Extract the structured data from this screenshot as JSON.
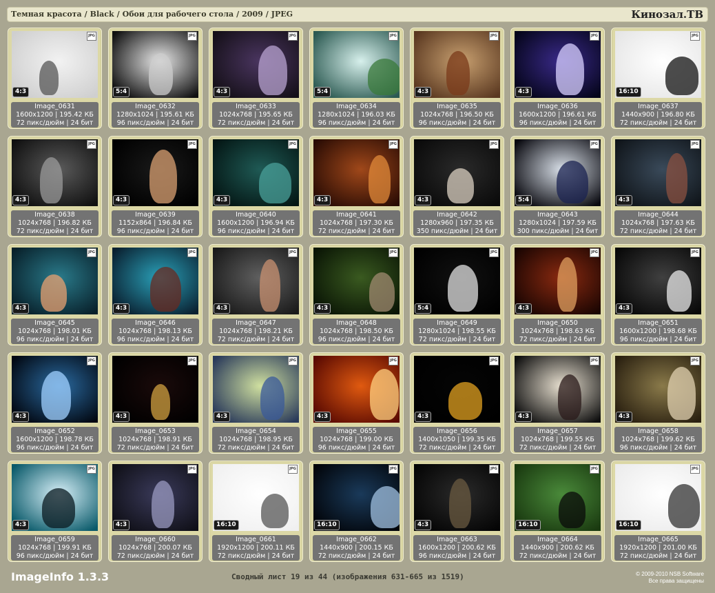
{
  "header": {
    "breadcrumb": [
      "Темная красота",
      "Black",
      "Обои для рабочего стола",
      "2009",
      "JPEG"
    ],
    "separator": "/",
    "brand": "Кинозал.ТВ"
  },
  "file_badge": "JPG",
  "images": [
    {
      "name": "Image_0631",
      "ratio": "4:3",
      "dims": "1600x1200",
      "size": "195.42 КБ",
      "dpi": "72 пикс/дюйм",
      "bits": "24 бит",
      "c1": "#f2f2f2",
      "c2": "#cfcfcf",
      "f": "#555"
    },
    {
      "name": "Image_0632",
      "ratio": "5:4",
      "dims": "1280x1024",
      "size": "195.61 КБ",
      "dpi": "96 пикс/дюйм",
      "bits": "24 бит",
      "c1": "#e8e8e8",
      "c2": "#111111",
      "f": "#ccc"
    },
    {
      "name": "Image_0633",
      "ratio": "4:3",
      "dims": "1024x768",
      "size": "195.65 КБ",
      "dpi": "72 пикс/дюйм",
      "bits": "24 бит",
      "c1": "#4a3560",
      "c2": "#151018",
      "f": "#b8a3d0"
    },
    {
      "name": "Image_0634",
      "ratio": "5:4",
      "dims": "1280x1024",
      "size": "196.03 КБ",
      "dpi": "96 пикс/дюйм",
      "bits": "24 бит",
      "c1": "#d7f0ec",
      "c2": "#2c5a52",
      "f": "#3a7a3a"
    },
    {
      "name": "Image_0635",
      "ratio": "4:3",
      "dims": "1024x768",
      "size": "196.50 КБ",
      "dpi": "96 пикс/дюйм",
      "bits": "24 бит",
      "c1": "#c8a070",
      "c2": "#5a3820",
      "f": "#7a3a1a"
    },
    {
      "name": "Image_0636",
      "ratio": "4:3",
      "dims": "1600x1200",
      "size": "196.61 КБ",
      "dpi": "96 пикс/дюйм",
      "bits": "24 бит",
      "c1": "#3a2a8a",
      "c2": "#05051a",
      "f": "#d8d0ff"
    },
    {
      "name": "Image_0637",
      "ratio": "16:10",
      "dims": "1440x900",
      "size": "196.80 КБ",
      "dpi": "72 пикс/дюйм",
      "bits": "24 бит",
      "c1": "#ffffff",
      "c2": "#e6e6e6",
      "f": "#111"
    },
    {
      "name": "Image_0638",
      "ratio": "4:3",
      "dims": "1024x768",
      "size": "196.82 КБ",
      "dpi": "72 пикс/дюйм",
      "bits": "24 бит",
      "c1": "#5a5a5a",
      "c2": "#101010",
      "f": "#999"
    },
    {
      "name": "Image_0639",
      "ratio": "4:3",
      "dims": "1152x864",
      "size": "196.84 КБ",
      "dpi": "96 пикс/дюйм",
      "bits": "24 бит",
      "c1": "#1a1a1a",
      "c2": "#000000",
      "f": "#d9a072"
    },
    {
      "name": "Image_0640",
      "ratio": "4:3",
      "dims": "1600x1200",
      "size": "196.94 КБ",
      "dpi": "96 пикс/дюйм",
      "bits": "24 бит",
      "c1": "#1f5a55",
      "c2": "#041614",
      "f": "#4aa09a"
    },
    {
      "name": "Image_0641",
      "ratio": "4:3",
      "dims": "1024x768",
      "size": "197.30 КБ",
      "dpi": "72 пикс/дюйм",
      "bits": "24 бит",
      "c1": "#a0481a",
      "c2": "#2a0c04",
      "f": "#e08a3a"
    },
    {
      "name": "Image_0642",
      "ratio": "4:3",
      "dims": "1280x960",
      "size": "197.35 КБ",
      "dpi": "350 пикс/дюйм",
      "bits": "24 бит",
      "c1": "#2a2a2a",
      "c2": "#0a0a0a",
      "f": "#d9cfc0"
    },
    {
      "name": "Image_0643",
      "ratio": "5:4",
      "dims": "1280x1024",
      "size": "197.59 КБ",
      "dpi": "300 пикс/дюйм",
      "bits": "24 бит",
      "c1": "#d8dfe8",
      "c2": "#0a0a10",
      "f": "#1a2250"
    },
    {
      "name": "Image_0644",
      "ratio": "4:3",
      "dims": "1024x768",
      "size": "197.63 КБ",
      "dpi": "72 пикс/дюйм",
      "bits": "24 бит",
      "c1": "#3a4a5a",
      "c2": "#10151a",
      "f": "#8a5040"
    },
    {
      "name": "Image_0645",
      "ratio": "4:3",
      "dims": "1024x768",
      "size": "198.01 КБ",
      "dpi": "96 пикс/дюйм",
      "bits": "24 бит",
      "c1": "#2a7a8a",
      "c2": "#08202a",
      "f": "#e8a070"
    },
    {
      "name": "Image_0646",
      "ratio": "4:3",
      "dims": "1024x768",
      "size": "198.13 КБ",
      "dpi": "96 пикс/дюйм",
      "bits": "24 бит",
      "c1": "#2aa0b8",
      "c2": "#0a2030",
      "f": "#6a2a20"
    },
    {
      "name": "Image_0647",
      "ratio": "4:3",
      "dims": "1024x768",
      "size": "198.21 КБ",
      "dpi": "72 пикс/дюйм",
      "bits": "24 бит",
      "c1": "#606060",
      "c2": "#1a1a1a",
      "f": "#c89070"
    },
    {
      "name": "Image_0648",
      "ratio": "4:3",
      "dims": "1024x768",
      "size": "198.50 КБ",
      "dpi": "96 пикс/дюйм",
      "bits": "24 бит",
      "c1": "#3a5a20",
      "c2": "#0a1505",
      "f": "#a08a70"
    },
    {
      "name": "Image_0649",
      "ratio": "5:4",
      "dims": "1280x1024",
      "size": "198.55 КБ",
      "dpi": "72 пикс/дюйм",
      "bits": "24 бит",
      "c1": "#111111",
      "c2": "#000000",
      "f": "#e0e0e0"
    },
    {
      "name": "Image_0650",
      "ratio": "4:3",
      "dims": "1024x768",
      "size": "198.63 КБ",
      "dpi": "72 пикс/дюйм",
      "bits": "24 бит",
      "c1": "#8a2a10",
      "c2": "#1a0502",
      "f": "#e0a060"
    },
    {
      "name": "Image_0651",
      "ratio": "4:3",
      "dims": "1600x1200",
      "size": "198.68 КБ",
      "dpi": "96 пикс/дюйм",
      "bits": "24 бит",
      "c1": "#404040",
      "c2": "#080808",
      "f": "#e8e8e8"
    },
    {
      "name": "Image_0652",
      "ratio": "4:3",
      "dims": "1600x1200",
      "size": "198.78 КБ",
      "dpi": "96 пикс/дюйм",
      "bits": "24 бит",
      "c1": "#2a6aa0",
      "c2": "#020812",
      "f": "#a0d0ff"
    },
    {
      "name": "Image_0653",
      "ratio": "4:3",
      "dims": "1024x768",
      "size": "198.91 КБ",
      "dpi": "72 пикс/дюйм",
      "bits": "24 бит",
      "c1": "#1a0a0a",
      "c2": "#000000",
      "f": "#d0a040"
    },
    {
      "name": "Image_0654",
      "ratio": "4:3",
      "dims": "1024x768",
      "size": "198.95 КБ",
      "dpi": "72 пикс/дюйм",
      "bits": "24 бит",
      "c1": "#d0e0a0",
      "c2": "#2a3a5a",
      "f": "#3a5a9a"
    },
    {
      "name": "Image_0655",
      "ratio": "4:3",
      "dims": "1024x768",
      "size": "199.00 КБ",
      "dpi": "96 пикс/дюйм",
      "bits": "24 бит",
      "c1": "#e05a10",
      "c2": "#5a0a02",
      "f": "#ffd080"
    },
    {
      "name": "Image_0656",
      "ratio": "4:3",
      "dims": "1400x1050",
      "size": "199.35 КБ",
      "dpi": "72 пикс/дюйм",
      "bits": "24 бит",
      "c1": "#050505",
      "c2": "#000000",
      "f": "#e0a020"
    },
    {
      "name": "Image_0657",
      "ratio": "4:3",
      "dims": "1024x768",
      "size": "199.55 КБ",
      "dpi": "72 пикс/дюйм",
      "bits": "24 бит",
      "c1": "#e8e0d0",
      "c2": "#101010",
      "f": "#2a1a1a"
    },
    {
      "name": "Image_0658",
      "ratio": "4:3",
      "dims": "1024x768",
      "size": "199.62 КБ",
      "dpi": "96 пикс/дюйм",
      "bits": "24 бит",
      "c1": "#8a7a4a",
      "c2": "#2a2010",
      "f": "#e0d0b0"
    },
    {
      "name": "Image_0659",
      "ratio": "4:3",
      "dims": "1024x768",
      "size": "199.91 КБ",
      "dpi": "96 пикс/дюйм",
      "bits": "24 бит",
      "c1": "#d8f0f8",
      "c2": "#0a5a6a",
      "f": "#0a1a20"
    },
    {
      "name": "Image_0660",
      "ratio": "4:3",
      "dims": "1024x768",
      "size": "200.07 КБ",
      "dpi": "72 пикс/дюйм",
      "bits": "24 бит",
      "c1": "#3a3a5a",
      "c2": "#101018",
      "f": "#9a9ac0"
    },
    {
      "name": "Image_0661",
      "ratio": "16:10",
      "dims": "1920x1200",
      "size": "200.11 КБ",
      "dpi": "72 пикс/дюйм",
      "bits": "24 бит",
      "c1": "#ffffff",
      "c2": "#f0f0f0",
      "f": "#555"
    },
    {
      "name": "Image_0662",
      "ratio": "16:10",
      "dims": "1440x900",
      "size": "200.15 КБ",
      "dpi": "72 пикс/дюйм",
      "bits": "24 бит",
      "c1": "#1a3a5a",
      "c2": "#02050a",
      "f": "#a0c0e0"
    },
    {
      "name": "Image_0663",
      "ratio": "4:3",
      "dims": "1600x1200",
      "size": "200.62 КБ",
      "dpi": "96 пикс/дюйм",
      "bits": "24 бит",
      "c1": "#2a2a2a",
      "c2": "#050505",
      "f": "#6a5a40"
    },
    {
      "name": "Image_0664",
      "ratio": "16:10",
      "dims": "1440x900",
      "size": "200.62 КБ",
      "dpi": "72 пикс/дюйм",
      "bits": "24 бит",
      "c1": "#4a8a3a",
      "c2": "#1a3a10",
      "f": "#0a0a0a"
    },
    {
      "name": "Image_0665",
      "ratio": "16:10",
      "dims": "1920x1200",
      "size": "201.00 КБ",
      "dpi": "72 пикс/дюйм",
      "bits": "24 бит",
      "c1": "#ffffff",
      "c2": "#ececec",
      "f": "#333"
    }
  ],
  "footer": {
    "app": "ImageInfo 1.3.3",
    "sheet": "Сводный лист 19 из 44 (изображения 631-665 из 1519)",
    "copyright": "© 2009-2010 NSB Software",
    "rights": "Все права защищены"
  }
}
